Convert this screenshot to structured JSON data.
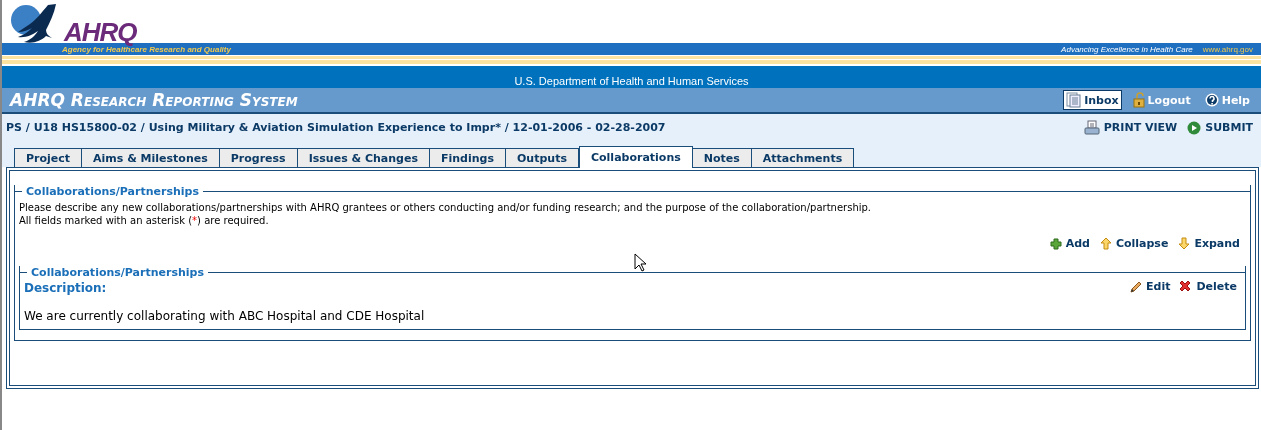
{
  "header": {
    "logo_text": "AHRQ",
    "agency": "Agency for Healthcare Research and Quality",
    "tagline": "Advancing Excellence in Health Care",
    "url": "www.ahrq.gov",
    "department": "U.S. Department of Health and Human Services"
  },
  "system_title": "AHRQ Research Reporting System",
  "user_menu": [
    {
      "kind": "inbox",
      "label": "Inbox",
      "selected": true
    },
    {
      "kind": "logout",
      "label": "Logout",
      "selected": false
    },
    {
      "kind": "help",
      "label": "Help",
      "selected": false
    }
  ],
  "breadcrumb": "PS / U18 HS15800-02 / Using Military & Aviation Simulation Experience to Impr* / 12-01-2006 - 02-28-2007",
  "page_actions": [
    {
      "kind": "print",
      "label": "PRINT VIEW"
    },
    {
      "kind": "submit",
      "label": "SUBMIT"
    }
  ],
  "tabs": [
    {
      "label": "Project",
      "selected": false
    },
    {
      "label": "Aims & Milestones",
      "selected": false
    },
    {
      "label": "Progress",
      "selected": false
    },
    {
      "label": "Issues & Changes",
      "selected": false
    },
    {
      "label": "Findings",
      "selected": false
    },
    {
      "label": "Outputs",
      "selected": false
    },
    {
      "label": "Collaborations",
      "selected": true
    },
    {
      "label": "Notes",
      "selected": false
    },
    {
      "label": "Attachments",
      "selected": false
    }
  ],
  "section": {
    "legend": "Collaborations/Partnerships",
    "instructions": "Please describe any new collaborations/partnerships with AHRQ grantees or others conducting and/or funding research; and the purpose of the collaboration/partnership.",
    "required_note": {
      "before": "All fields marked with an asterisk (",
      "mark": "*",
      "after": ") are required."
    },
    "toolbar": [
      {
        "kind": "add",
        "label": "Add"
      },
      {
        "kind": "collapse",
        "label": "Collapse"
      },
      {
        "kind": "expand",
        "label": "Expand"
      }
    ],
    "entries": [
      {
        "legend": "Collaborations/Partnerships",
        "field_label": "Description:",
        "value": "We are currently collaborating with ABC Hospital and CDE Hospital",
        "actions": [
          {
            "kind": "edit",
            "label": "Edit"
          },
          {
            "kind": "delete",
            "label": "Delete"
          }
        ]
      }
    ]
  }
}
